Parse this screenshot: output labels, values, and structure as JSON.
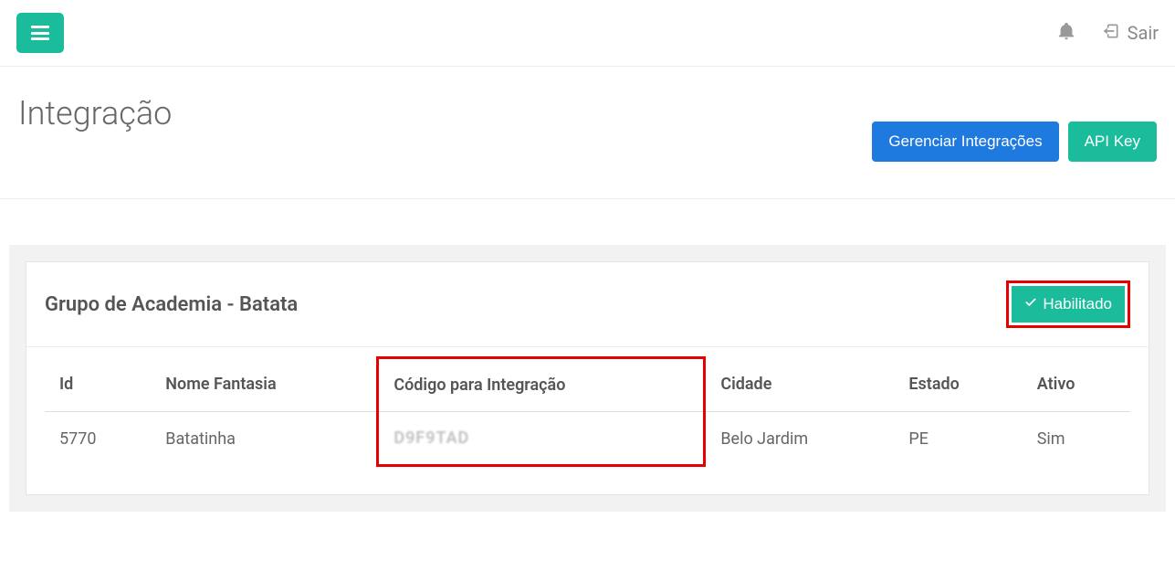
{
  "topbar": {
    "logout": "Sair"
  },
  "header": {
    "title": "Integração",
    "manage_btn": "Gerenciar Integrações",
    "apikey_btn": "API Key"
  },
  "card": {
    "title": "Grupo de Academia - Batata",
    "status_label": "Habilitado"
  },
  "table": {
    "columns": {
      "id": "Id",
      "nome": "Nome Fantasia",
      "codigo": "Código para Integração",
      "cidade": "Cidade",
      "estado": "Estado",
      "ativo": "Ativo"
    },
    "rows": [
      {
        "id": "5770",
        "nome": "Batatinha",
        "codigo": "D9F9TAD",
        "cidade": "Belo Jardim",
        "estado": "PE",
        "ativo": "Sim"
      }
    ]
  }
}
